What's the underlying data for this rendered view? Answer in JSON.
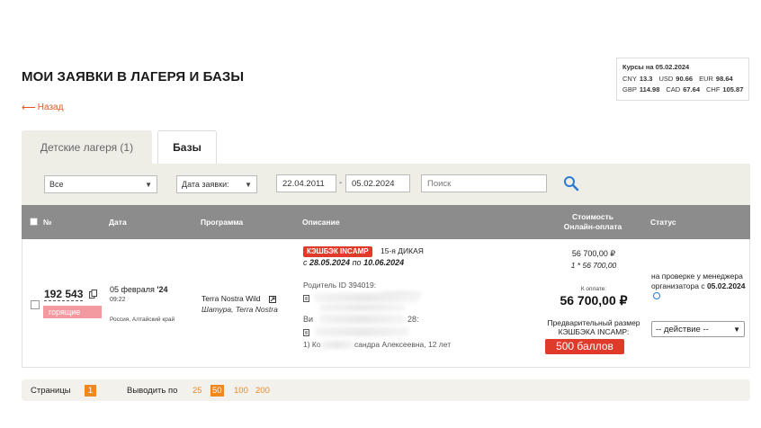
{
  "page": {
    "title": "МОИ ЗАЯВКИ В ЛАГЕРЯ И БАЗЫ",
    "back_arrow": "⟵",
    "back_label": "Назад"
  },
  "rates": {
    "title": "Курсы на 05.02.2024",
    "items": [
      {
        "code": "CNY",
        "value": "13.3"
      },
      {
        "code": "USD",
        "value": "90.66"
      },
      {
        "code": "EUR",
        "value": "98.64"
      },
      {
        "code": "GBP",
        "value": "114.98"
      },
      {
        "code": "CAD",
        "value": "67.64"
      },
      {
        "code": "CHF",
        "value": "105.87"
      }
    ]
  },
  "tabs": [
    {
      "label": "Детские лагеря (1)",
      "active": false
    },
    {
      "label": "Базы",
      "active": true
    }
  ],
  "filters": {
    "status_select": "Все",
    "date_type_select": "Дата заявки:",
    "date_from": "22.04.2011",
    "date_separator": "-",
    "date_to": "05.02.2024",
    "search_placeholder": "Поиск"
  },
  "table": {
    "headers": {
      "num": "№",
      "date": "Дата",
      "program": "Программа",
      "description": "Описание",
      "cost_line1": "Стоимость",
      "cost_line2": "Онлайн-оплата",
      "status": "Статус"
    },
    "rows": [
      {
        "order_number": "192 543",
        "badge": "горящие",
        "date_day": "05 февраля",
        "date_year": "'24",
        "time": "09:22",
        "region": "Россия, Алтайский край",
        "program_name": "Terra Nostra Wild",
        "program_location": "Шатура, Terra Nostra",
        "cashback_badge": "КЭШБЭК INCAMP",
        "shift_title": "15-я ДИКАЯ",
        "dates_prefix": "с",
        "dates_from": "28.05.2024",
        "dates_mid": "по",
        "dates_to": "10.06.2024",
        "parent_label": "Родитель ID 394019:",
        "extra_prefix": "Ви",
        "extra_suffix": "28:",
        "child_prefix": "1) Ко",
        "child_suffix": "сандра Алексеевна, 12 лет",
        "price_total": "56 700,00 ₽",
        "price_online": "1 * 56 700,00",
        "to_pay_label": "К оплате:",
        "to_pay": "56 700,00 ₽",
        "cashback_label": "Предварительный размер КЭШБЭКА INCAMP:",
        "cashback_points": "500 баллов",
        "status_text": "на проверке у менеджера организатора с",
        "status_date": "05.02.2024",
        "action_select": "-- действие --"
      }
    ]
  },
  "footer": {
    "pages_label": "Страницы",
    "current_page": "1",
    "per_page_label": "Выводить по",
    "per_page_options": [
      "25",
      "50",
      "100",
      "200"
    ],
    "per_page_selected": "50"
  },
  "colors": {
    "accent": "#f0871f",
    "badge_red": "#e03a2a",
    "hot_pink": "#f29aa0",
    "header_gray": "#8c8c8c",
    "filter_bg": "#eeede6"
  }
}
